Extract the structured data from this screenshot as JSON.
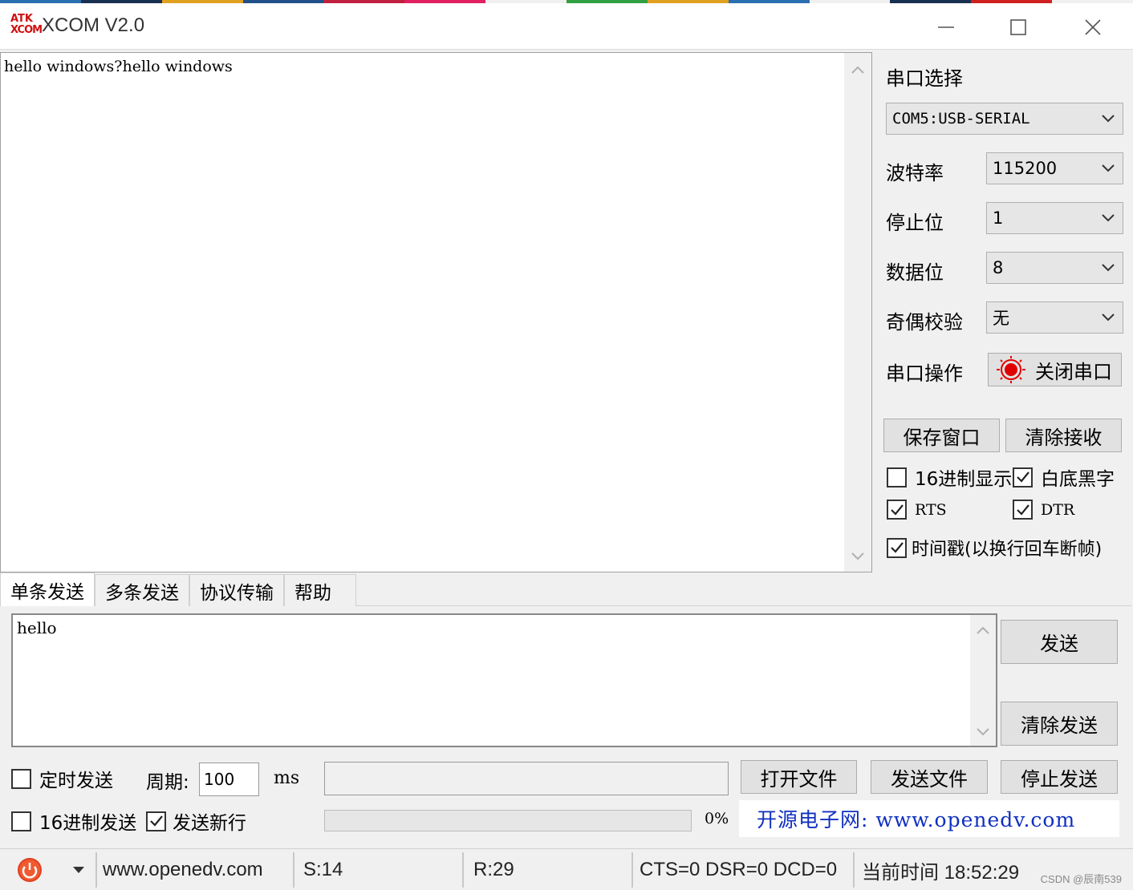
{
  "window": {
    "logo_line1": "ATK",
    "logo_line2": "XCOM",
    "title": "XCOM V2.0",
    "minimize": "—",
    "maximize": "☐",
    "close": "✕"
  },
  "receive": {
    "text": "hello windows?hello windows"
  },
  "serial": {
    "port_label": "串口选择",
    "port_value": "COM5:USB-SERIAL",
    "baud_label": "波特率",
    "baud_value": "115200",
    "stopbits_label": "停止位",
    "stopbits_value": "1",
    "databits_label": "数据位",
    "databits_value": "8",
    "parity_label": "奇偶校验",
    "parity_value": "无",
    "operation_label": "串口操作",
    "operation_button": "关闭串口",
    "status_color": "#e00000"
  },
  "actions": {
    "save_window": "保存窗口",
    "clear_receive": "清除接收"
  },
  "options": {
    "hex_display": {
      "label": "16进制显示",
      "checked": false
    },
    "white_bg": {
      "label": "白底黑字",
      "checked": true
    },
    "rts": {
      "label": "RTS",
      "checked": true
    },
    "dtr": {
      "label": "DTR",
      "checked": true
    },
    "timestamp": {
      "label": "时间戳(以换行回车断帧)",
      "checked": true
    }
  },
  "tabs": [
    "单条发送",
    "多条发送",
    "协议传输",
    "帮助"
  ],
  "send": {
    "text": "hello",
    "send_button": "发送",
    "clear_send_button": "清除发送",
    "timed_send": {
      "label": "定时发送",
      "checked": false
    },
    "period_label": "周期:",
    "period_value": "100",
    "period_unit": "ms",
    "open_file": "打开文件",
    "send_file": "发送文件",
    "stop_send": "停止发送",
    "hex_send": {
      "label": "16进制发送",
      "checked": false
    },
    "send_newline": {
      "label": "发送新行",
      "checked": true
    },
    "progress_text": "0%",
    "progress": 0,
    "banner": "开源电子网: www.openedv.com"
  },
  "statusbar": {
    "website": "www.openedv.com",
    "sent": "S:14",
    "received": "R:29",
    "signals": "CTS=0 DSR=0 DCD=0",
    "time": "当前时间 18:52:29",
    "watermark": "CSDN @辰南539"
  }
}
